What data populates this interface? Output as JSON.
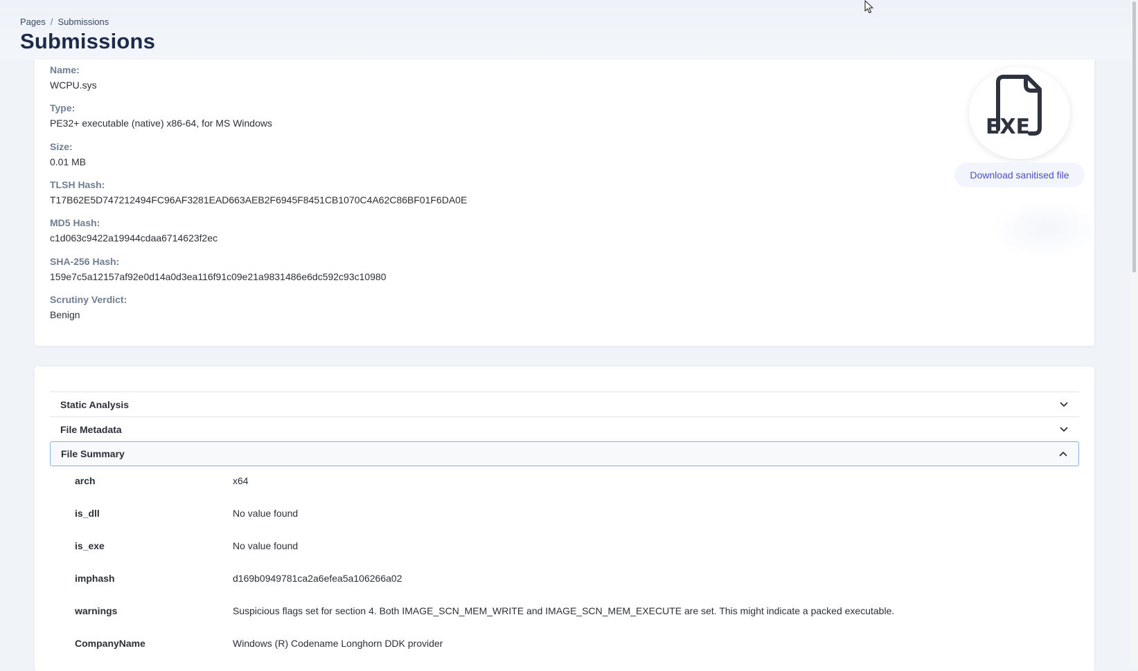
{
  "breadcrumb": {
    "root": "Pages",
    "separator": "/",
    "current": "Submissions"
  },
  "page": {
    "title": "Submissions"
  },
  "file_info": {
    "fields": [
      {
        "label": "Name:",
        "value": "WCPU.sys"
      },
      {
        "label": "Type:",
        "value": "PE32+ executable (native) x86-64, for MS Windows"
      },
      {
        "label": "Size:",
        "value": "0.01 MB"
      },
      {
        "label": "TLSH Hash:",
        "value": "T17B62E5D747212494FC96AF3281EAD663AEB2F6945F8451CB1070C4A62C86BF01F6DA0E"
      },
      {
        "label": "MD5 Hash:",
        "value": "c1d063c9422a19944cdaa6714623f2ec"
      },
      {
        "label": "SHA-256 Hash:",
        "value": "159e7c5a12157af92e0d14a0d3ea116f91c09e21a9831486e6dc592c93c10980"
      },
      {
        "label": "Scrutiny Verdict:",
        "value": "Benign"
      }
    ],
    "file_icon": "exe-file-icon",
    "file_icon_text": "EXE",
    "download_label": "Download sanitised file"
  },
  "accordion": {
    "sections": [
      {
        "title": "Static Analysis",
        "expanded": false,
        "icon": "chevron-down-icon"
      },
      {
        "title": "File Metadata",
        "expanded": false,
        "icon": "chevron-down-icon"
      },
      {
        "title": "File Summary",
        "expanded": true,
        "icon": "chevron-up-icon"
      }
    ]
  },
  "file_summary": [
    {
      "key": "arch",
      "value": "x64"
    },
    {
      "key": "is_dll",
      "value": "No value found"
    },
    {
      "key": "is_exe",
      "value": "No value found"
    },
    {
      "key": "imphash",
      "value": "d169b0949781ca2a6efea5a106266a02"
    },
    {
      "key": "warnings",
      "value": "Suspicious flags set for section 4. Both IMAGE_SCN_MEM_WRITE and IMAGE_SCN_MEM_EXECUTE are set. This might indicate a packed executable."
    },
    {
      "key": "CompanyName",
      "value": "Windows (R) Codename Longhorn DDK provider"
    }
  ],
  "colors": {
    "accent": "#4a4fc4",
    "title": "#1d2a4a",
    "label": "#6f7d92",
    "focus_border": "#84b0e0"
  }
}
